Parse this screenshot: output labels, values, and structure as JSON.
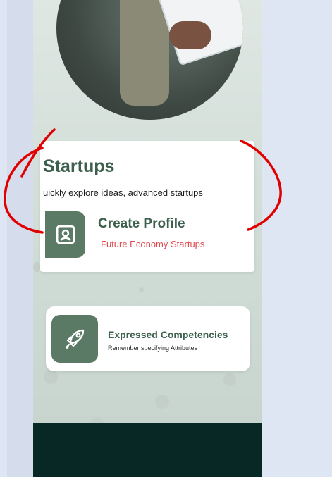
{
  "section": {
    "title": "Startups",
    "subtitle": "uickly explore ideas, advanced startups"
  },
  "cards": [
    {
      "title": "Create Profile",
      "subtitle": "Future Economy Startups",
      "icon": "profile-id-icon"
    },
    {
      "title": "Expressed Competencies",
      "subtitle": "Remember specifying Attributes",
      "icon": "rocket-icon"
    }
  ],
  "colors": {
    "accent_green": "#3d5f4e",
    "icon_tile": "#5b7a66",
    "highlight_red": "#e24b4f",
    "footer": "#082826",
    "annotation_red": "#e00000"
  }
}
